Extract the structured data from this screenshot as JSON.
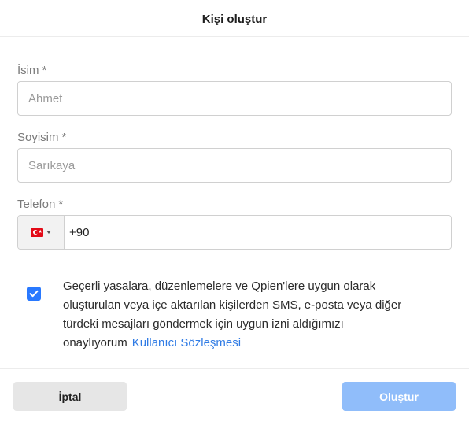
{
  "dialog": {
    "title": "Kişi oluştur"
  },
  "form": {
    "first_name": {
      "label": "İsim",
      "required_mark": "*",
      "placeholder": "Ahmet",
      "value": ""
    },
    "last_name": {
      "label": "Soyisim",
      "required_mark": "*",
      "placeholder": "Sarıkaya",
      "value": ""
    },
    "phone": {
      "label": "Telefon",
      "required_mark": "*",
      "country_flag_icon": "turkey-flag-icon",
      "value": "+90"
    },
    "consent": {
      "checked": true,
      "text": "Geçerli yasalara, düzenlemelere ve Qpien'lere uygun olarak oluşturulan veya içe aktarılan kişilerden SMS, e-posta veya diğer türdeki mesajları göndermek için uygun izni aldığımızı onaylıyorum",
      "link_label": "Kullanıcı Sözleşmesi"
    }
  },
  "footer": {
    "cancel_label": "İptal",
    "submit_label": "Oluştur"
  },
  "colors": {
    "accent": "#2979ff",
    "link": "#2f7be5",
    "submit_disabled": "#90bdfa"
  }
}
